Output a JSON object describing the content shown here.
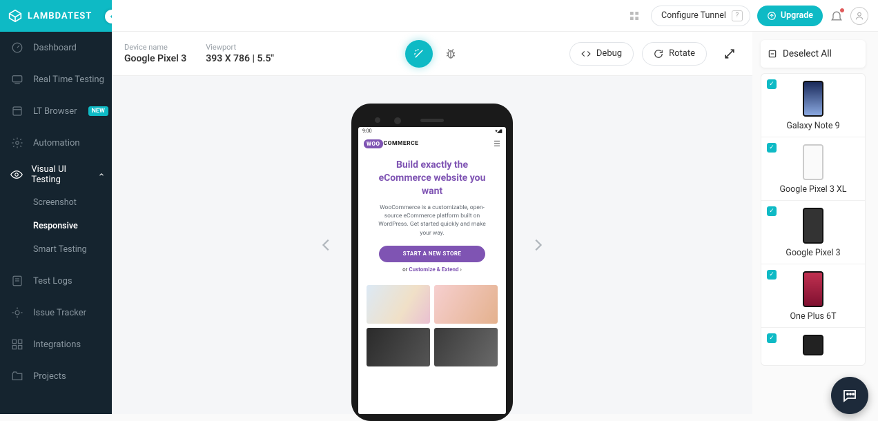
{
  "brand": "LAMBDATEST",
  "sidebar": {
    "items": [
      {
        "label": "Dashboard"
      },
      {
        "label": "Real Time Testing"
      },
      {
        "label": "LT Browser",
        "badge": "NEW"
      },
      {
        "label": "Automation"
      },
      {
        "label": "Visual UI Testing"
      },
      {
        "label": "Test Logs"
      },
      {
        "label": "Issue Tracker"
      },
      {
        "label": "Integrations"
      },
      {
        "label": "Projects"
      }
    ],
    "subitems": [
      {
        "label": "Screenshot"
      },
      {
        "label": "Responsive"
      },
      {
        "label": "Smart Testing"
      }
    ]
  },
  "topbar": {
    "tunnel": "Configure Tunnel",
    "tunnel_help": "?",
    "upgrade": "Upgrade"
  },
  "main": {
    "device_label": "Device name",
    "device_value": "Google Pixel 3",
    "viewport_label": "Viewport",
    "viewport_value": "393 X 786 | 5.5\"",
    "debug": "Debug",
    "rotate": "Rotate"
  },
  "preview": {
    "status_time": "9:00",
    "status_icons": "▾◢▮",
    "logo_bubble": "WOO",
    "logo_text": "COMMERCE",
    "hero_title_l1": "Build exactly the",
    "hero_title_l2": "eCommerce website you",
    "hero_title_l3": "want",
    "hero_desc": "WooCommerce is a customizable, open-source eCommerce platform built on WordPress. Get started quickly and make your way.",
    "cta": "START A NEW STORE",
    "sub_or": "or ",
    "sub_strong": "Customize & Extend",
    "sub_arrow": " ›"
  },
  "devpanel": {
    "head": "Deselect All",
    "items": [
      {
        "label": "Galaxy Note 9"
      },
      {
        "label": "Google Pixel 3 XL"
      },
      {
        "label": "Google Pixel 3"
      },
      {
        "label": "One Plus 6T"
      }
    ]
  }
}
